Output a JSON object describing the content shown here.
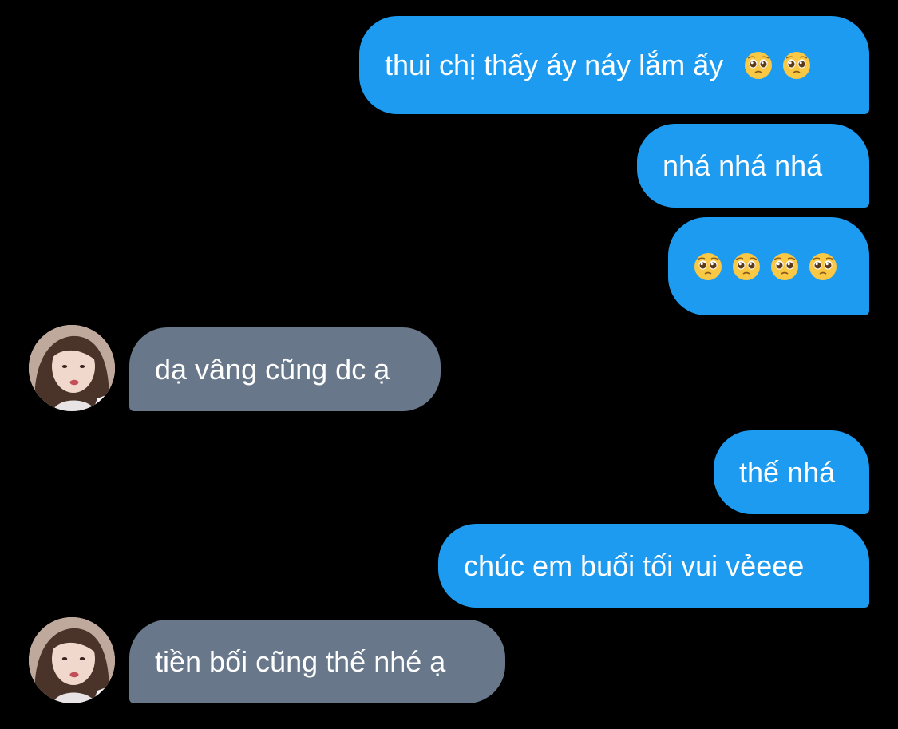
{
  "colors": {
    "background": "#000000",
    "sent_bubble": "#1d9bf0",
    "received_bubble": "#68778a",
    "text": "#ffffff"
  },
  "messages": [
    {
      "direction": "sent",
      "text": "thui chị thấy áy náy lắm ấy",
      "emojis": [
        "pleading-face-emoji",
        "pleading-face-emoji"
      ]
    },
    {
      "direction": "sent",
      "text": "nhá nhá nhá",
      "emojis": []
    },
    {
      "direction": "sent",
      "text": "",
      "emojis": [
        "pleading-face-emoji",
        "pleading-face-emoji",
        "pleading-face-emoji",
        "pleading-face-emoji"
      ]
    },
    {
      "direction": "received",
      "text": "dạ vâng cũng dc ạ",
      "emojis": []
    },
    {
      "direction": "sent",
      "text": "thế nhá",
      "emojis": []
    },
    {
      "direction": "sent",
      "text": "chúc em buổi tối vui vẻeee",
      "emojis": []
    },
    {
      "direction": "received",
      "text": "tiền bối cũng thế nhé ạ",
      "emojis": []
    }
  ]
}
